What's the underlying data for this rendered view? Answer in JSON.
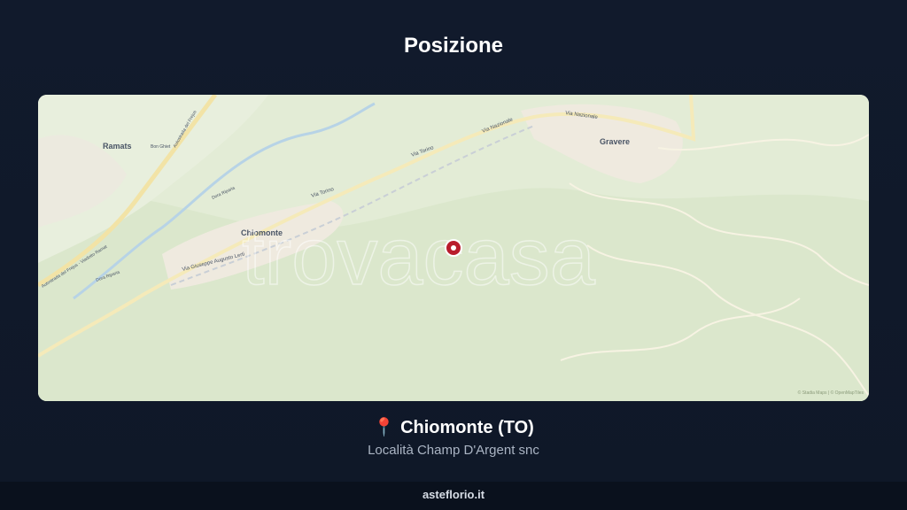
{
  "header": {
    "title": "Posizione"
  },
  "map": {
    "watermark": "trovacasa",
    "attribution": "© Stadia Maps | © OpenMapTiles",
    "labels": {
      "ramats": "Ramats",
      "ramats_sub": "Bon Ghiet",
      "chiomonte": "Chiomonte",
      "gravere": "Gravere",
      "via_torino_1": "Via Torino",
      "via_torino_2": "Via Torino",
      "via_nazionale_1": "Via Nazionale",
      "via_nazionale_2": "Via Nazionale",
      "via_lerti": "Via Giuseppe Augusto Lerti",
      "autostrada_1": "Autostrada del Frejus",
      "autostrada_2": "Autostrada del Frejus - Viadotto Ramat",
      "dora_1": "Dora Riparia",
      "dora_2": "Dora Riparia"
    }
  },
  "location": {
    "pin_icon": "📍",
    "name": "Chiomonte (TO)",
    "address": "Località Champ D'Argent snc"
  },
  "footer": {
    "site": "asteflorio.it"
  }
}
